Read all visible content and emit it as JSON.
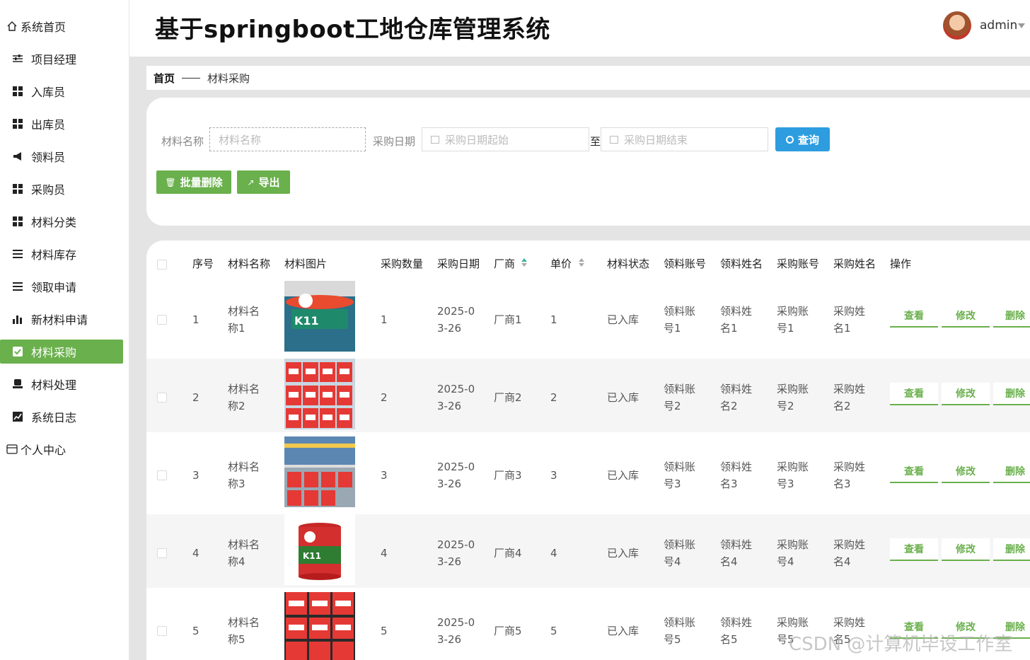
{
  "app": {
    "title": "基于springboot工地仓库管理系统",
    "user": "admin"
  },
  "sidebar": {
    "home": "系统首页",
    "items": [
      {
        "label": "项目经理",
        "icon": "sliders-icon"
      },
      {
        "label": "入库员",
        "icon": "grid-icon"
      },
      {
        "label": "出库员",
        "icon": "grid-icon"
      },
      {
        "label": "领料员",
        "icon": "bullhorn-icon"
      },
      {
        "label": "采购员",
        "icon": "grid-icon"
      },
      {
        "label": "材料分类",
        "icon": "grid-icon"
      },
      {
        "label": "材料库存",
        "icon": "list-icon"
      },
      {
        "label": "领取申请",
        "icon": "list-icon"
      },
      {
        "label": "新材料申请",
        "icon": "bar-chart-icon"
      },
      {
        "label": "材料采购",
        "icon": "check-square-icon",
        "active": true
      },
      {
        "label": "材料处理",
        "icon": "stamp-icon"
      },
      {
        "label": "系统日志",
        "icon": "line-chart-icon"
      }
    ],
    "profile": "个人中心"
  },
  "breadcrumb": {
    "home": "首页",
    "current": "材料采购"
  },
  "search": {
    "name_label": "材料名称",
    "name_placeholder": "材料名称",
    "date_label": "采购日期",
    "date_start_placeholder": "采购日期起始",
    "date_to": "至",
    "date_end_placeholder": "采购日期结束",
    "query_button": "查询",
    "batch_delete_button": "批量删除",
    "export_button": "导出"
  },
  "table": {
    "headers": {
      "index": "序号",
      "name": "材料名称",
      "image": "材料图片",
      "qty": "采购数量",
      "date": "采购日期",
      "vendor": "厂商",
      "price": "单价",
      "status": "材料状态",
      "recv_account": "领料账号",
      "recv_name": "领料姓名",
      "buy_account": "采购账号",
      "buy_name": "采购姓名",
      "ops": "操作"
    },
    "ops": {
      "view": "查看",
      "edit": "修改",
      "delete": "删除"
    },
    "rows": [
      {
        "index": "1",
        "name_a": "材料名",
        "name_b": "称1",
        "qty": "1",
        "date_a": "2025-0",
        "date_b": "3-26",
        "vendor": "厂商1",
        "price": "1",
        "status": "已入库",
        "ra_a": "领料账",
        "ra_b": "号1",
        "rn_a": "领料姓",
        "rn_b": "名1",
        "ba_a": "采购账",
        "ba_b": "号1",
        "bn_a": "采购姓",
        "bn_b": "名1"
      },
      {
        "index": "2",
        "name_a": "材料名",
        "name_b": "称2",
        "qty": "2",
        "date_a": "2025-0",
        "date_b": "3-26",
        "vendor": "厂商2",
        "price": "2",
        "status": "已入库",
        "ra_a": "领料账",
        "ra_b": "号2",
        "rn_a": "领料姓",
        "rn_b": "名2",
        "ba_a": "采购账",
        "ba_b": "号2",
        "bn_a": "采购姓",
        "bn_b": "名2"
      },
      {
        "index": "3",
        "name_a": "材料名",
        "name_b": "称3",
        "qty": "3",
        "date_a": "2025-0",
        "date_b": "3-26",
        "vendor": "厂商3",
        "price": "3",
        "status": "已入库",
        "ra_a": "领料账",
        "ra_b": "号3",
        "rn_a": "领料姓",
        "rn_b": "名3",
        "ba_a": "采购账",
        "ba_b": "号3",
        "bn_a": "采购姓",
        "bn_b": "名3"
      },
      {
        "index": "4",
        "name_a": "材料名",
        "name_b": "称4",
        "qty": "4",
        "date_a": "2025-0",
        "date_b": "3-26",
        "vendor": "厂商4",
        "price": "4",
        "status": "已入库",
        "ra_a": "领料账",
        "ra_b": "号4",
        "rn_a": "领料姓",
        "rn_b": "名4",
        "ba_a": "采购账",
        "ba_b": "号4",
        "bn_a": "采购姓",
        "bn_b": "名4"
      },
      {
        "index": "5",
        "name_a": "材料名",
        "name_b": "称5",
        "qty": "5",
        "date_a": "2025-0",
        "date_b": "3-26",
        "vendor": "厂商5",
        "price": "5",
        "status": "已入库",
        "ra_a": "领料账",
        "ra_b": "号5",
        "rn_a": "领料姓",
        "rn_b": "名5",
        "ba_a": "采购账",
        "ba_b": "号5",
        "bn_a": "采购姓",
        "bn_b": "名5"
      }
    ]
  },
  "watermark": "CSDN @计算机毕设工作室",
  "colors": {
    "accent_green": "#6ab04c",
    "query_blue": "#2d9de0",
    "sort_active": "#3cb39a"
  }
}
